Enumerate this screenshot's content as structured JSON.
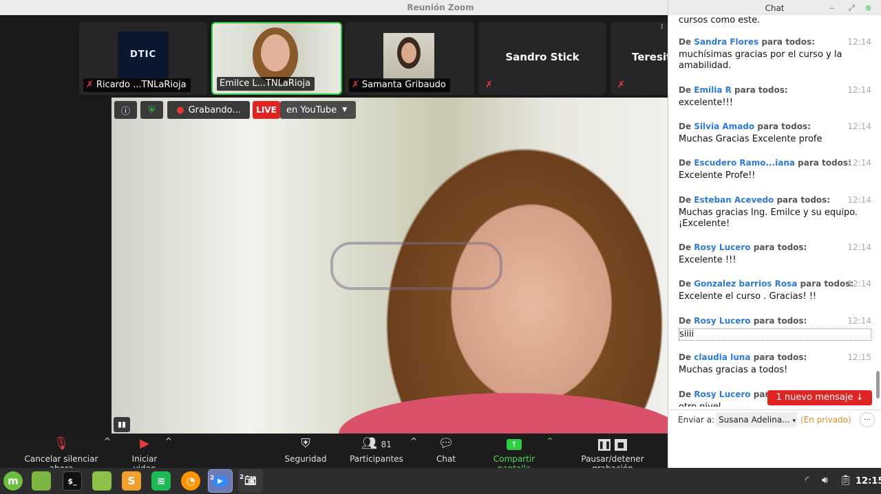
{
  "window": {
    "title": "Reunión Zoom"
  },
  "thumbnails": [
    {
      "name": "Ricardo ...TNLaRioja",
      "logo_text": "DTIC",
      "muted": true
    },
    {
      "name": "Emilce L...TNLaRioja",
      "muted": false,
      "active": true
    },
    {
      "name": "Samanta Gribaudo",
      "muted": true
    },
    {
      "name": "Sandro Stick",
      "muted": true
    },
    {
      "name": "Teresit",
      "muted": true
    }
  ],
  "video_overlay": {
    "recording_label": "Grabando...",
    "live_label": "LIVE",
    "youtube_label": "en YouTube"
  },
  "toolbar": {
    "unmute_label": "Cancelar silenciar ahora",
    "video_label": "Iniciar video",
    "security_label": "Seguridad",
    "participants_label": "Participantes",
    "participants_count": "81",
    "chat_label": "Chat",
    "share_label": "Compartir pantalla",
    "record_label": "Pausar/detener grabación"
  },
  "chat": {
    "title": "Chat",
    "top_fragment": "cursos como este.",
    "to_all": "para todos:",
    "from_prefix": "De",
    "messages": [
      {
        "sender": "Sandra Flores",
        "time": "12:14",
        "text": "muchísimas gracias por el curso y la amabilidad."
      },
      {
        "sender": "Emilia R",
        "time": "12:14",
        "text": "excelente!!!"
      },
      {
        "sender": "Silvia Amado",
        "time": "12:14",
        "text": "Muchas Gracias Excelente profe"
      },
      {
        "sender": "Escudero Ramo...iana",
        "time": "12:14",
        "text": "Excelente Profe!!"
      },
      {
        "sender": "Esteban Acevedo",
        "time": "12:14",
        "text": "Muchas gracias Ing. Emilce y su equipo. ¡Excelente!"
      },
      {
        "sender": "Rosy Lucero",
        "time": "12:14",
        "text": "Excelente !!!"
      },
      {
        "sender": "Gonzalez barrios Rosa",
        "time": "12:14",
        "text": "Excelente el curso . Gracias! !!"
      },
      {
        "sender": "Rosy Lucero",
        "time": "12:14",
        "text": "siiii"
      },
      {
        "sender": "claudia luna",
        "time": "12:15",
        "text": "Muchas gracias a todos!"
      },
      {
        "sender": "Rosy Lucero",
        "time": "12:15",
        "text": "otro nivel"
      }
    ],
    "new_message_label": "1 nuevo mensaje ↓",
    "send_to_label": "Enviar a:",
    "recipient": "Susana Adelina...",
    "private_label": "(En privado)",
    "more_label": "···"
  },
  "taskbar": {
    "clock": "12:15",
    "zoom_badge": "2",
    "camera_badge": "2"
  }
}
